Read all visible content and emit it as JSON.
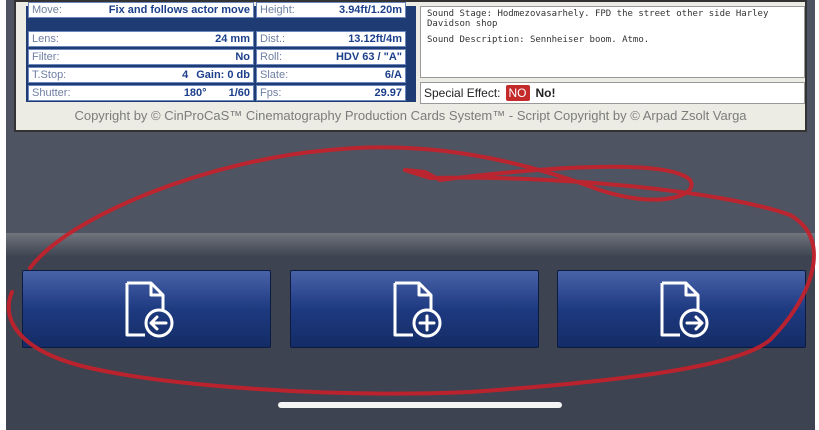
{
  "card": {
    "rows": [
      {
        "l1": "Move:",
        "v1": "Fix and follows actor move",
        "l2": "Height:",
        "v2": "3.94ft/1.20m"
      },
      {
        "l1": "Lens:",
        "v1": "24 mm",
        "l2": "Dist.:",
        "v2": "13.12ft/4m"
      },
      {
        "l1": "Filter:",
        "v1": "No",
        "l2": "Roll:",
        "v2": "HDV 63 / \"A\""
      },
      {
        "l1": "T.Stop:",
        "v1a": "4",
        "v1b": "Gain: 0 db",
        "l2": "Slate:",
        "v2": "6/A"
      },
      {
        "l1": "Shutter:",
        "v1a": "180°",
        "v1b": "1/60",
        "l2": "Fps:",
        "v2": "29.97"
      }
    ],
    "sound_stage": "Sound Stage: Hodmezovasarhely. FPD the street  other side Harley Davidson shop",
    "sound_description": "Sound Description: Sennheiser boom. Atmo.",
    "special_effect_label": "Special Effect:",
    "special_effect_badge": "NO",
    "special_effect_value": "No!",
    "copyright": "Copyright by © CinProCaS™ Cinematography Production Cards System™ - Script Copyright by © Arpad Zsolt Varga"
  },
  "buttons": [
    {
      "icon": "document-previous-icon"
    },
    {
      "icon": "document-add-icon"
    },
    {
      "icon": "document-next-icon"
    }
  ],
  "colors": {
    "button_blue": "#1e3a80",
    "badge_red": "#c42a2a",
    "annotation_red": "#c8202a"
  }
}
